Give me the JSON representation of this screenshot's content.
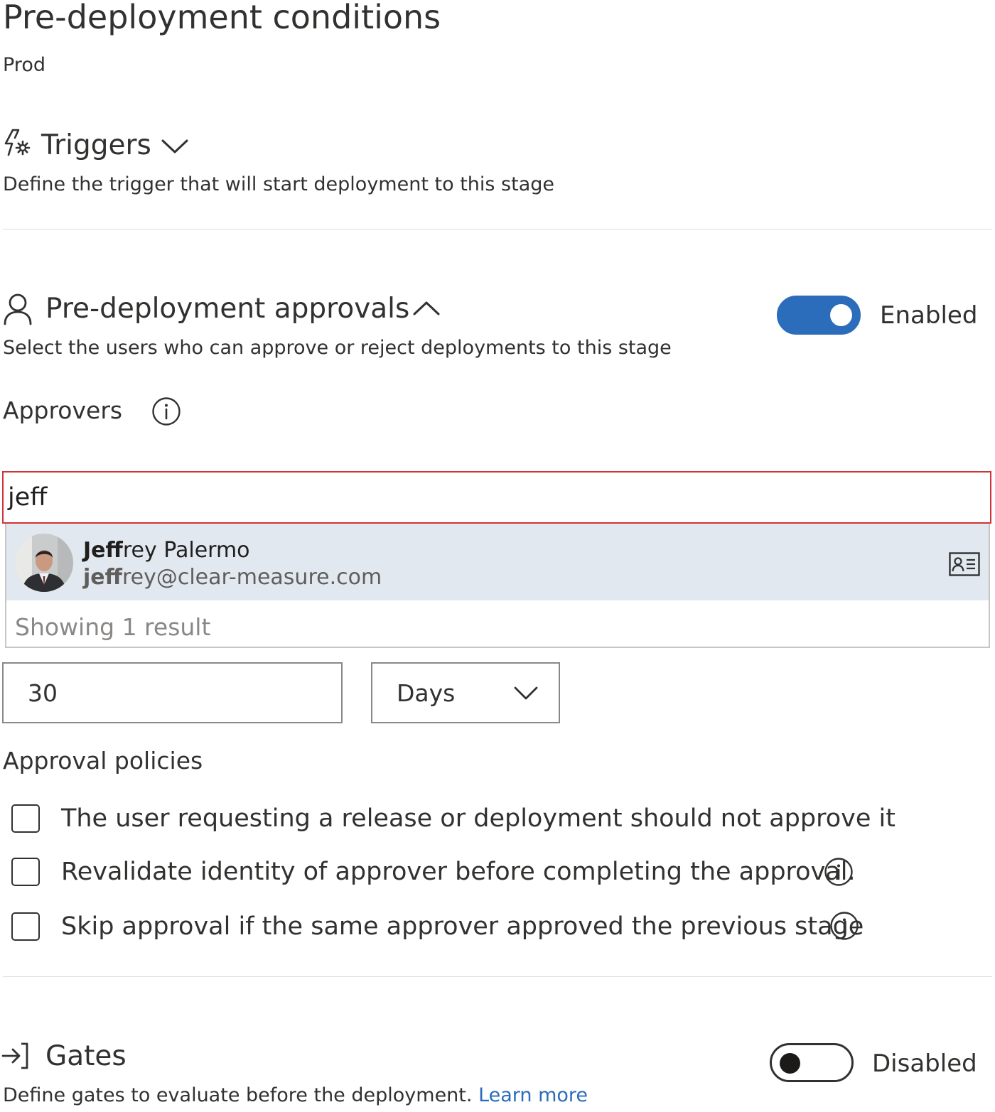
{
  "page": {
    "title": "Pre-deployment conditions",
    "stage": "Prod"
  },
  "triggers": {
    "title": "Triggers",
    "description": "Define the trigger that will start deployment to this stage"
  },
  "approvals": {
    "title": "Pre-deployment approvals",
    "description": "Select the users who can approve or reject deployments to this stage",
    "toggle_label": "Enabled",
    "enabled": true,
    "approvers_label": "Approvers",
    "search": {
      "value": "jeff",
      "results": [
        {
          "name_match": "Jeff",
          "name_rest": "rey Palermo",
          "email_match": "jeff",
          "email_rest": "rey@clear-measure.com"
        }
      ],
      "result_count_text": "Showing 1 result"
    },
    "timeout": {
      "value": "30",
      "unit": "Days"
    },
    "policies_label": "Approval policies",
    "policies": [
      {
        "label": "The user requesting a release or deployment should not approve it",
        "checked": false,
        "info": false
      },
      {
        "label": "Revalidate identity of approver before completing the approval.",
        "checked": false,
        "info": true
      },
      {
        "label": "Skip approval if the same approver approved the previous stage",
        "checked": false,
        "info": true
      }
    ]
  },
  "gates": {
    "title": "Gates",
    "description": "Define gates to evaluate before the deployment.",
    "learn_more": "Learn more",
    "toggle_label": "Disabled",
    "enabled": false
  },
  "colors": {
    "accent": "#2b6cbb",
    "error_border": "#d13438",
    "selected_row": "#e1e8f0",
    "text": "#323130"
  }
}
